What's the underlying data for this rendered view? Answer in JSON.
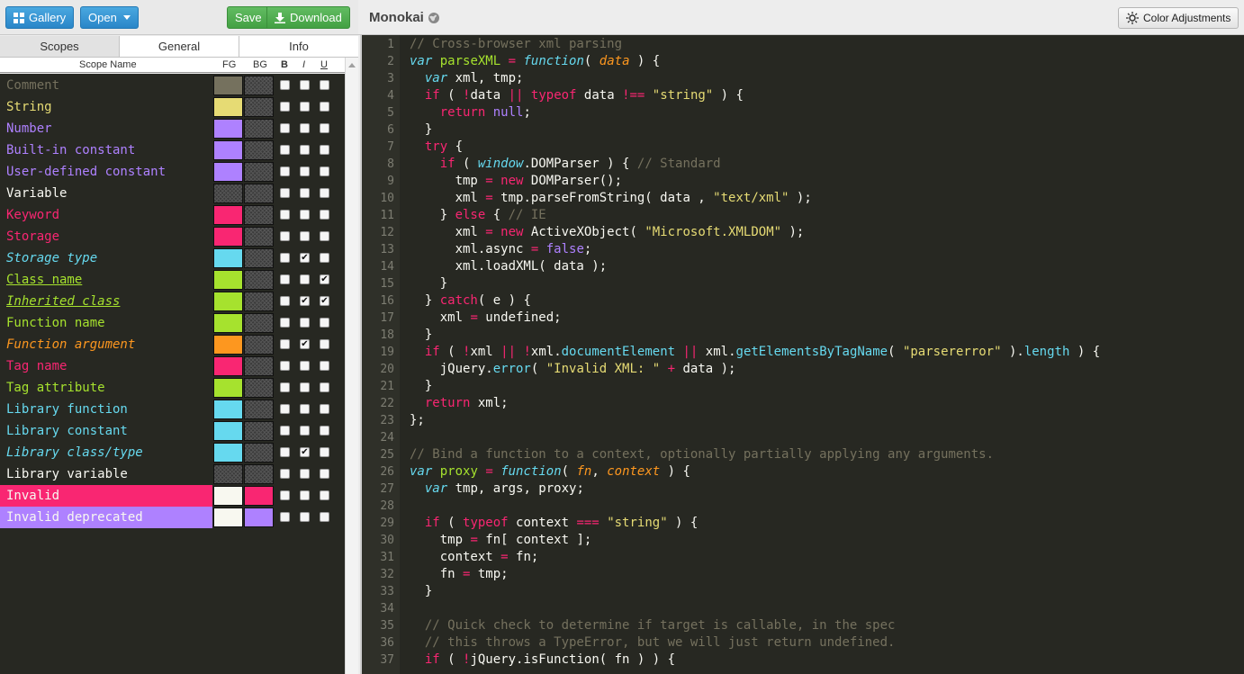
{
  "toolbar": {
    "gallery_label": "Gallery",
    "open_label": "Open",
    "save_label": "Save",
    "download_label": "Download",
    "theme_name": "Monokai",
    "color_adjustments_label": "Color Adjustments"
  },
  "tabs": [
    {
      "label": "Scopes",
      "active": true
    },
    {
      "label": "General",
      "active": false
    },
    {
      "label": "Info",
      "active": false
    }
  ],
  "columns": {
    "scope_name": "Scope Name",
    "fg": "FG",
    "bg": "BG",
    "b": "B",
    "i": "I",
    "u": "U"
  },
  "scopes": [
    {
      "name": "Comment",
      "color": "#75715e",
      "fg": "#75715e",
      "bg": null,
      "bold": false,
      "italic": false,
      "underline": false
    },
    {
      "name": "String",
      "color": "#e6db74",
      "fg": "#e6db74",
      "bg": null,
      "bold": false,
      "italic": false,
      "underline": false
    },
    {
      "name": "Number",
      "color": "#ae81ff",
      "fg": "#ae81ff",
      "bg": null,
      "bold": false,
      "italic": false,
      "underline": false
    },
    {
      "name": "Built-in constant",
      "color": "#ae81ff",
      "fg": "#ae81ff",
      "bg": null,
      "bold": false,
      "italic": false,
      "underline": false
    },
    {
      "name": "User-defined constant",
      "color": "#ae81ff",
      "fg": "#ae81ff",
      "bg": null,
      "bold": false,
      "italic": false,
      "underline": false
    },
    {
      "name": "Variable",
      "color": "#f8f8f2",
      "fg": null,
      "bg": null,
      "bold": false,
      "italic": false,
      "underline": false
    },
    {
      "name": "Keyword",
      "color": "#f92672",
      "fg": "#f92672",
      "bg": null,
      "bold": false,
      "italic": false,
      "underline": false
    },
    {
      "name": "Storage",
      "color": "#f92672",
      "fg": "#f92672",
      "bg": null,
      "bold": false,
      "italic": false,
      "underline": false
    },
    {
      "name": "Storage type",
      "color": "#66d9ef",
      "fg": "#66d9ef",
      "bg": null,
      "bold": false,
      "italic": true,
      "underline": false
    },
    {
      "name": "Class name",
      "color": "#a6e22e",
      "fg": "#a6e22e",
      "bg": null,
      "bold": false,
      "italic": false,
      "underline": true
    },
    {
      "name": "Inherited class",
      "color": "#a6e22e",
      "fg": "#a6e22e",
      "bg": null,
      "bold": false,
      "italic": true,
      "underline": true
    },
    {
      "name": "Function name",
      "color": "#a6e22e",
      "fg": "#a6e22e",
      "bg": null,
      "bold": false,
      "italic": false,
      "underline": false
    },
    {
      "name": "Function argument",
      "color": "#fd971f",
      "fg": "#fd971f",
      "bg": null,
      "bold": false,
      "italic": true,
      "underline": false
    },
    {
      "name": "Tag name",
      "color": "#f92672",
      "fg": "#f92672",
      "bg": null,
      "bold": false,
      "italic": false,
      "underline": false
    },
    {
      "name": "Tag attribute",
      "color": "#a6e22e",
      "fg": "#a6e22e",
      "bg": null,
      "bold": false,
      "italic": false,
      "underline": false
    },
    {
      "name": "Library function",
      "color": "#66d9ef",
      "fg": "#66d9ef",
      "bg": null,
      "bold": false,
      "italic": false,
      "underline": false
    },
    {
      "name": "Library constant",
      "color": "#66d9ef",
      "fg": "#66d9ef",
      "bg": null,
      "bold": false,
      "italic": false,
      "underline": false
    },
    {
      "name": "Library class/type",
      "color": "#66d9ef",
      "fg": "#66d9ef",
      "bg": null,
      "bold": false,
      "italic": true,
      "underline": false
    },
    {
      "name": "Library variable",
      "color": "#f8f8f2",
      "fg": null,
      "bg": null,
      "bold": false,
      "italic": false,
      "underline": false
    },
    {
      "name": "Invalid",
      "color": "#f8f8f0",
      "fg": "#f8f8f0",
      "bg": "#f92672",
      "bold": false,
      "italic": false,
      "underline": false
    },
    {
      "name": "Invalid deprecated",
      "color": "#f8f8f0",
      "fg": "#f8f8f0",
      "bg": "#ae81ff",
      "bold": false,
      "italic": false,
      "underline": false
    }
  ],
  "code_lines": [
    {
      "n": "1",
      "h": "<span class=\"c\">// Cross-browser xml parsing</span>"
    },
    {
      "n": "2",
      "h": "<span class=\"st\">var</span> <span class=\"fn\">parseXML</span> <span class=\"k\">=</span> <span class=\"st\">function</span>( <span class=\"ar\">data</span> ) {"
    },
    {
      "n": "3",
      "h": "  <span class=\"st\">var</span> xml, tmp;"
    },
    {
      "n": "4",
      "h": "  <span class=\"k\">if</span> ( <span class=\"k\">!</span>data <span class=\"k\">||</span> <span class=\"k\">typeof</span> data <span class=\"k\">!==</span> <span class=\"s\">\"string\"</span> ) {"
    },
    {
      "n": "5",
      "h": "    <span class=\"k\">return</span> <span class=\"n\">null</span>;"
    },
    {
      "n": "6",
      "h": "  }"
    },
    {
      "n": "7",
      "h": "  <span class=\"k\">try</span> {"
    },
    {
      "n": "8",
      "h": "    <span class=\"k\">if</span> ( <span class=\"lcls\">window</span>.DOMParser ) { <span class=\"c\">// Standard</span>"
    },
    {
      "n": "9",
      "h": "      tmp <span class=\"k\">=</span> <span class=\"k\">new</span> DOMParser();"
    },
    {
      "n": "10",
      "h": "      xml <span class=\"k\">=</span> tmp.parseFromString( data , <span class=\"s\">\"text/xml\"</span> );"
    },
    {
      "n": "11",
      "h": "    } <span class=\"k\">else</span> { <span class=\"c\">// IE</span>"
    },
    {
      "n": "12",
      "h": "      xml <span class=\"k\">=</span> <span class=\"k\">new</span> ActiveXObject( <span class=\"s\">\"Microsoft.XMLDOM\"</span> );"
    },
    {
      "n": "13",
      "h": "      xml.async <span class=\"k\">=</span> <span class=\"n\">false</span>;"
    },
    {
      "n": "14",
      "h": "      xml.loadXML( data );"
    },
    {
      "n": "15",
      "h": "    }"
    },
    {
      "n": "16",
      "h": "  } <span class=\"k\">catch</span>( e ) {"
    },
    {
      "n": "17",
      "h": "    xml <span class=\"k\">=</span> undefined;"
    },
    {
      "n": "18",
      "h": "  }"
    },
    {
      "n": "19",
      "h": "  <span class=\"k\">if</span> ( <span class=\"k\">!</span>xml <span class=\"k\">||</span> <span class=\"k\">!</span>xml.<span class=\"lf\">documentElement</span> <span class=\"k\">||</span> xml.<span class=\"lf\">getElementsByTagName</span>( <span class=\"s\">\"parsererror\"</span> ).<span class=\"lf\">length</span> ) {"
    },
    {
      "n": "20",
      "h": "    jQuery.<span class=\"lf\">error</span>( <span class=\"s\">\"Invalid XML: \"</span> <span class=\"k\">+</span> data );"
    },
    {
      "n": "21",
      "h": "  }"
    },
    {
      "n": "22",
      "h": "  <span class=\"k\">return</span> xml;"
    },
    {
      "n": "23",
      "h": "};"
    },
    {
      "n": "24",
      "h": ""
    },
    {
      "n": "25",
      "h": "<span class=\"c\">// Bind a function to a context, optionally partially applying any arguments.</span>"
    },
    {
      "n": "26",
      "h": "<span class=\"st\">var</span> <span class=\"fn\">proxy</span> <span class=\"k\">=</span> <span class=\"st\">function</span>( <span class=\"ar\">fn</span>, <span class=\"ar\">context</span> ) {"
    },
    {
      "n": "27",
      "h": "  <span class=\"st\">var</span> tmp, args, proxy;"
    },
    {
      "n": "28",
      "h": ""
    },
    {
      "n": "29",
      "h": "  <span class=\"k\">if</span> ( <span class=\"k\">typeof</span> context <span class=\"k\">===</span> <span class=\"s\">\"string\"</span> ) {"
    },
    {
      "n": "30",
      "h": "    tmp <span class=\"k\">=</span> fn[ context ];"
    },
    {
      "n": "31",
      "h": "    context <span class=\"k\">=</span> fn;"
    },
    {
      "n": "32",
      "h": "    fn <span class=\"k\">=</span> tmp;"
    },
    {
      "n": "33",
      "h": "  }"
    },
    {
      "n": "34",
      "h": ""
    },
    {
      "n": "35",
      "h": "  <span class=\"c\">// Quick check to determine if target is callable, in the spec</span>"
    },
    {
      "n": "36",
      "h": "  <span class=\"c\">// this throws a TypeError, but we will just return undefined.</span>"
    },
    {
      "n": "37",
      "h": "  <span class=\"k\">if</span> ( <span class=\"k\">!</span>jQuery.isFunction( fn ) ) {"
    }
  ]
}
